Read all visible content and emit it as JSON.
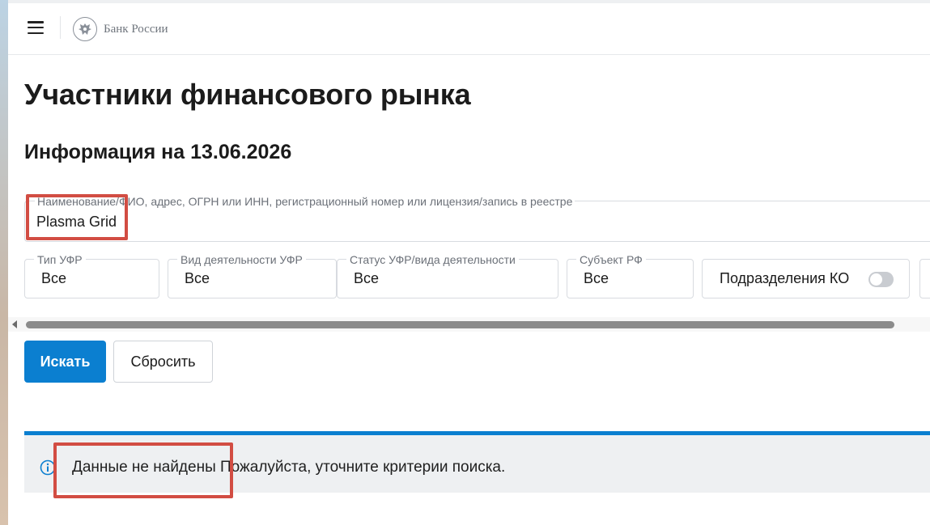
{
  "header": {
    "menu_icon": "hamburger-menu-icon",
    "logo_icon": "double-headed-eagle-emblem",
    "logo_text": "Банк России"
  },
  "page": {
    "title": "Участники финансового рынка",
    "subtitle": "Информация на 13.06.2026"
  },
  "search": {
    "label": "Наименование/ФИО, адрес, ОГРН или ИНН, регистрационный номер или лицензия/запись в реестре",
    "value": "Plasma Grid"
  },
  "filters": [
    {
      "label": "Тип УФР",
      "value": "Все"
    },
    {
      "label": "Вид деятельности УФР",
      "value": "Все"
    },
    {
      "label": "Статус УФР/вида деятельности",
      "value": "Все"
    },
    {
      "label": "Субъект РФ",
      "value": "Все"
    }
  ],
  "toggle": {
    "label": "Подразделения КО",
    "state": "off"
  },
  "buttons": {
    "search": "Искать",
    "reset": "Сбросить"
  },
  "alert": {
    "icon": "info-icon",
    "title": "Данные не найдены",
    "message": " Пожалуйста, уточните критерии поиска."
  },
  "colors": {
    "primary": "#0b7fd0",
    "annotation": "#d24d43",
    "alert_bg": "#eef0f2"
  }
}
